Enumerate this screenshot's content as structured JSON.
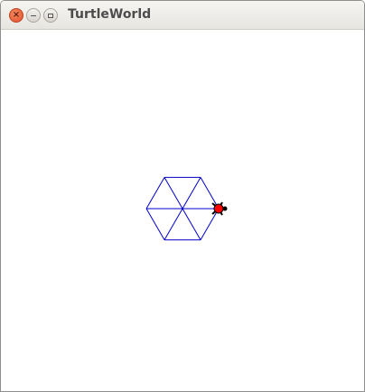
{
  "window": {
    "title": "TurtleWorld"
  },
  "icons": {
    "close": "close-icon",
    "minimize": "minimize-icon",
    "maximize": "maximize-icon",
    "turtle": "turtle-icon"
  },
  "colors": {
    "pen": "#0000cc",
    "turtle_body": "#ff0000",
    "turtle_outline": "#000000"
  },
  "drawing": {
    "shape": "hexagon with spokes",
    "sides": 6
  }
}
